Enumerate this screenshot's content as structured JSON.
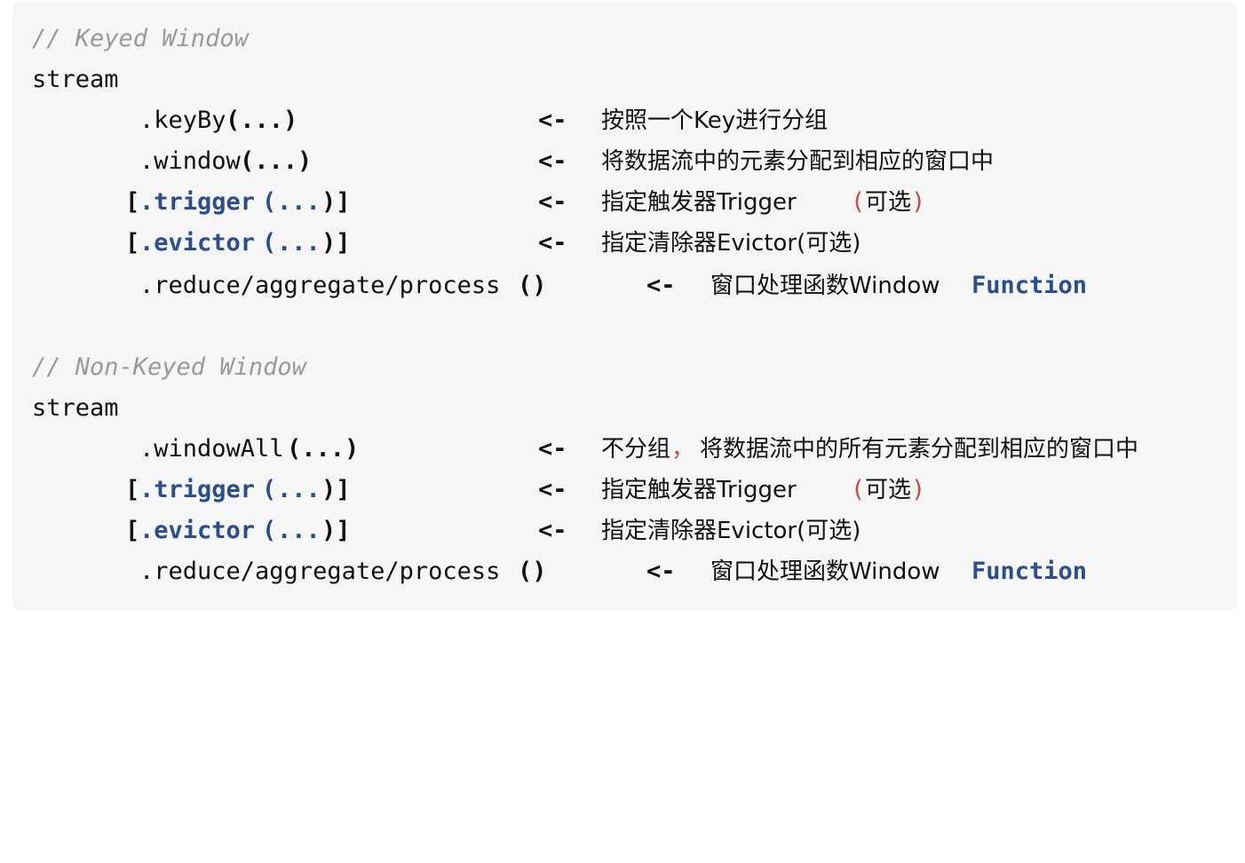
{
  "keyed": {
    "comment": "// Keyed Window",
    "stream": "stream",
    "keyBy_method": ".keyBy",
    "keyBy_args": "(...)",
    "keyBy_arrow": "<-",
    "keyBy_desc": "按照一个Key进行分组",
    "window_method": ".window",
    "window_args": "(...)",
    "window_arrow": "<-",
    "window_desc": "将数据流中的元素分配到相应的窗口中",
    "trigger_open": "[",
    "trigger_method": ".trigger",
    "trigger_args_open": "(",
    "trigger_dots": "...",
    "trigger_close": ")]",
    "trigger_arrow": "<-",
    "trigger_desc": "指定触发器Trigger ",
    "trigger_paren_open": "(",
    "trigger_optional": "可选",
    "trigger_paren_close": ")",
    "evictor_open": "[",
    "evictor_method": ".evictor",
    "evictor_args_open": "(",
    "evictor_dots": "...",
    "evictor_close": ")]",
    "evictor_arrow": "<-",
    "evictor_desc": "指定清除器Evictor(可选)",
    "reduce_method": ".reduce/aggregate/process",
    "reduce_parens": "()",
    "reduce_arrow": "<-",
    "reduce_desc": "窗口处理函数Window ",
    "reduce_function": "Function"
  },
  "nonkeyed": {
    "comment": "// Non-Keyed Window",
    "stream": "stream",
    "windowAll_method": ".windowAll",
    "windowAll_args": "(...)",
    "windowAll_arrow": "<-",
    "windowAll_desc_a": "不分组",
    "windowAll_comma": "，",
    "windowAll_desc_b": "将数据流中的所有元素分配到相应的窗口中",
    "trigger_open": "[",
    "trigger_method": ".trigger",
    "trigger_args_open": "(",
    "trigger_dots": "...",
    "trigger_close": ")]",
    "trigger_arrow": "<-",
    "trigger_desc": "指定触发器Trigger ",
    "trigger_paren_open": "(",
    "trigger_optional": "可选",
    "trigger_paren_close": ")",
    "evictor_open": "[",
    "evictor_method": ".evictor",
    "evictor_args_open": "(",
    "evictor_dots": "...",
    "evictor_close": ")]",
    "evictor_arrow": "<-",
    "evictor_desc": "指定清除器Evictor(可选)",
    "reduce_method": ".reduce/aggregate/process",
    "reduce_parens": "()",
    "reduce_arrow": "<-",
    "reduce_desc": "窗口处理函数Window ",
    "reduce_function": "Function"
  }
}
